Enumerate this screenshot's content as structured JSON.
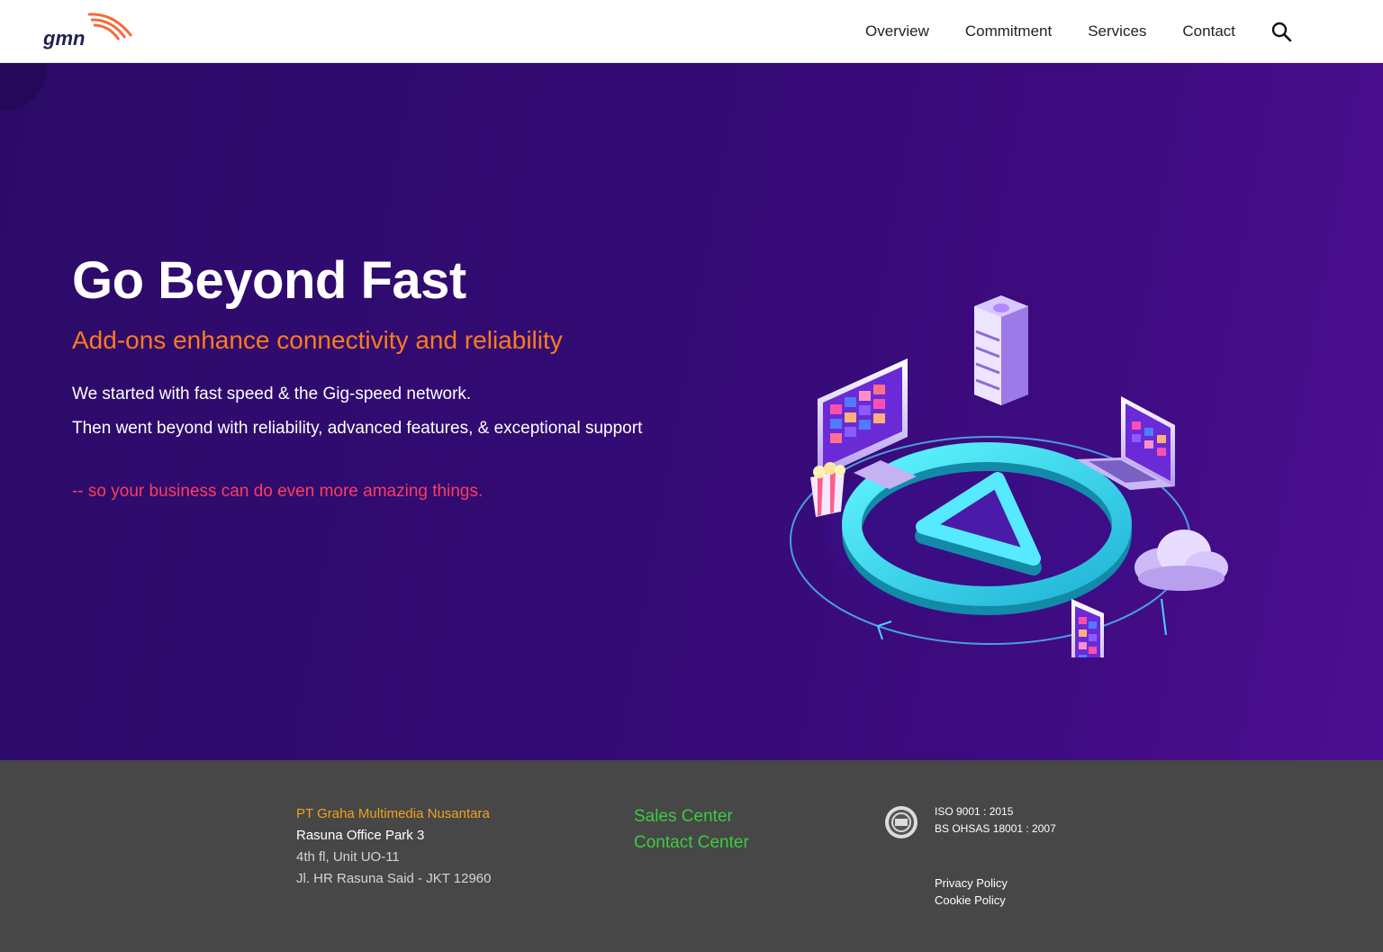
{
  "header": {
    "logo_text": "gmn",
    "nav": [
      "Overview",
      "Commitment",
      "Services",
      "Contact"
    ],
    "search_icon": "search-icon"
  },
  "hero": {
    "title": "Go Beyond Fast",
    "subtitle": "Add-ons enhance connectivity and reliability",
    "line1": "We started with fast speed & the Gig-speed network.",
    "line2": "Then went beyond with reliability, advanced features, & exceptional support",
    "line3": "-- so your business can do even more amazing things.",
    "illustration": "isometric-network-illustration"
  },
  "footer": {
    "company": "PT Graha Multimedia Nusantara",
    "address1": "Rasuna Office Park 3",
    "address2": "4th fl, Unit UO-11",
    "address3": "Jl. HR Rasuna Said - JKT 12960",
    "sales": "Sales Center",
    "contact": "Contact Center",
    "iso": "ISO 9001 : 2015",
    "ohsas": "BS OHSAS 18001 : 2007",
    "privacy": "Privacy Policy",
    "cookie": "Cookie Policy",
    "badge_icon": "certification-badge-icon"
  },
  "colors": {
    "hero_bg": "#330b74",
    "accent_orange": "#ff7a1e",
    "accent_red": "#ff3d5e",
    "footer_bg": "#474747",
    "footer_gold": "#f0a21c",
    "footer_green": "#3ccc3f"
  }
}
